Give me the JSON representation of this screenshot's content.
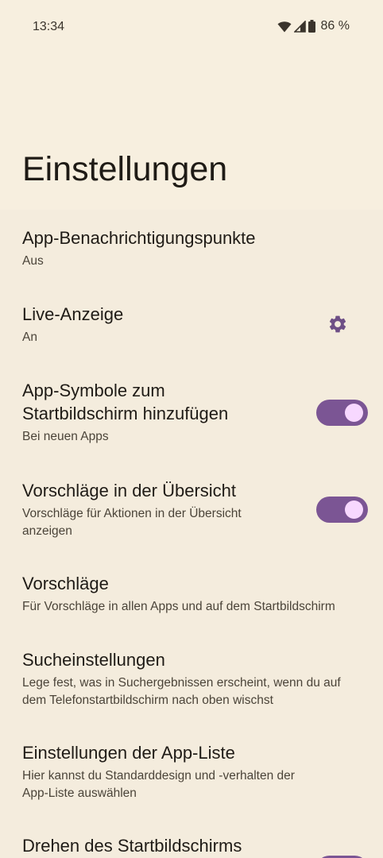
{
  "status_bar": {
    "time": "13:34",
    "battery": "86 %",
    "icons": [
      "wifi-icon",
      "signal-icon",
      "battery-icon"
    ]
  },
  "page": {
    "title": "Einstellungen"
  },
  "accent_color": "#7b5594",
  "settings": {
    "notification_dots": {
      "title": "App-Benachrichtigungspunkte",
      "subtitle": "Aus"
    },
    "live_display": {
      "title": "Live-Anzeige",
      "subtitle": "An",
      "icon": "gear-icon"
    },
    "add_icons": {
      "title_line1": "App-Symbole zum",
      "title_line2": "Startbildschirm hinzufügen",
      "subtitle": "Bei neuen Apps",
      "enabled": true
    },
    "overview_suggestions": {
      "title": "Vorschläge in der Übersicht",
      "subtitle_line1": "Vorschläge für Aktionen in der Übersicht",
      "subtitle_line2": "anzeigen",
      "enabled": true
    },
    "suggestions": {
      "title": "Vorschläge",
      "subtitle": "Für Vorschläge in allen Apps und auf dem Startbildschirm"
    },
    "search_settings": {
      "title": "Sucheinstellungen",
      "subtitle_line1": "Lege fest, was in Suchergebnissen erscheint, wenn du auf",
      "subtitle_line2": "dem Telefonstartbildschirm nach oben wischst"
    },
    "app_list_settings": {
      "title": "Einstellungen der App-Liste",
      "subtitle_line1": "Hier kannst du Standarddesign und -verhalten der",
      "subtitle_line2": "App-Liste auswählen"
    },
    "rotate_home": {
      "title": "Drehen des Startbildschirms",
      "enabled": true
    }
  }
}
